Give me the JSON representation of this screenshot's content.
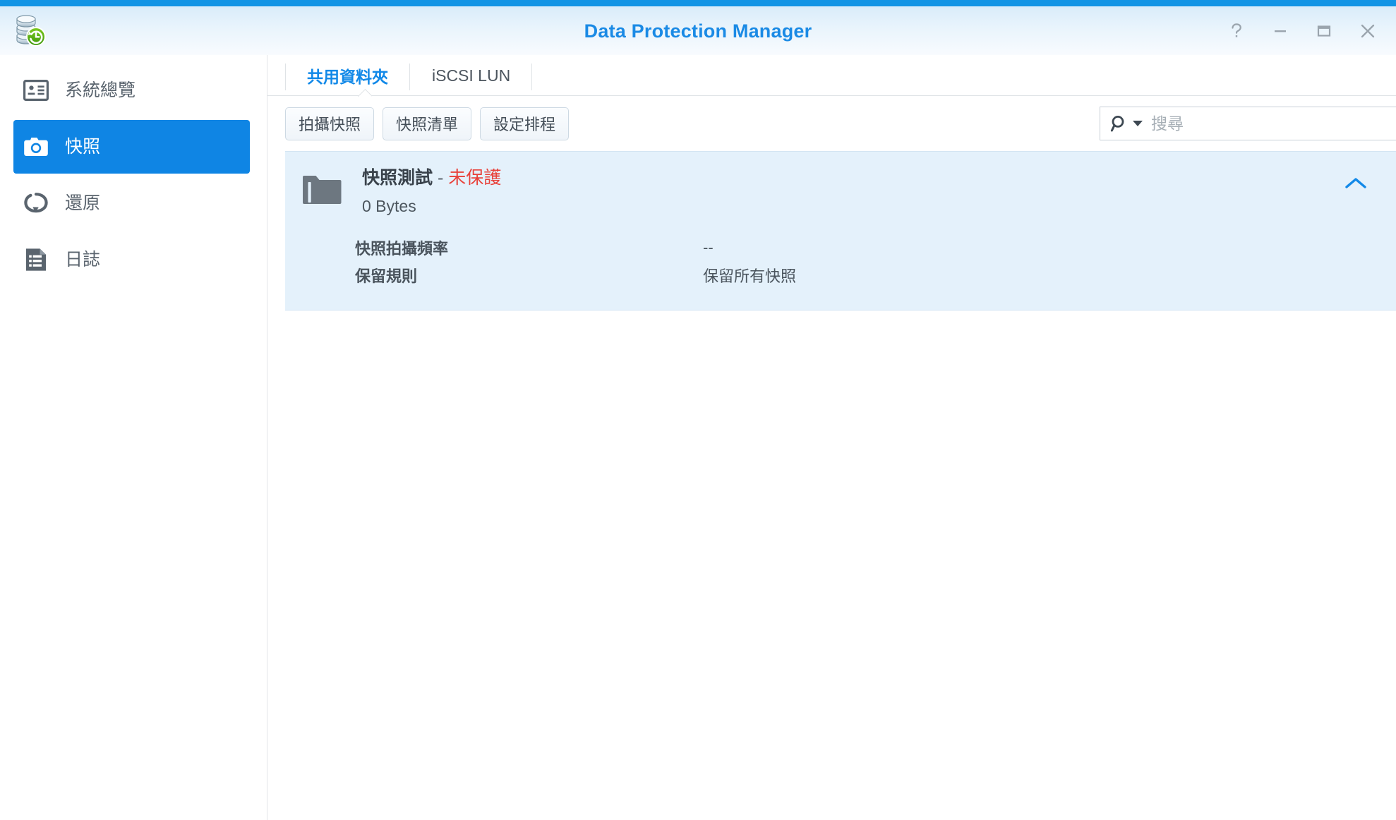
{
  "window": {
    "title": "Data Protection Manager",
    "app_icon": "database-restore-icon",
    "controls": [
      {
        "name": "help-button",
        "icon": "question-mark-icon",
        "label": "?"
      },
      {
        "name": "minimize-button",
        "icon": "minimize-icon",
        "label": "—"
      },
      {
        "name": "maximize-button",
        "icon": "maximize-icon",
        "label": "□"
      },
      {
        "name": "close-button",
        "icon": "close-icon",
        "label": "✕"
      }
    ]
  },
  "colors": {
    "accent_bar": "#1294e5",
    "title_text": "#1a8ae5",
    "sidebar_active_bg": "#0f85e4",
    "tab_active_text": "#1289e8",
    "card_bg": "#e4f1fb",
    "status_unprotected": "#e8413a",
    "chevron": "#1289e8"
  },
  "sidebar": {
    "items": [
      {
        "label": "系統總覽",
        "icon": "system-overview-icon",
        "active": false
      },
      {
        "label": "快照",
        "icon": "camera-icon",
        "active": true
      },
      {
        "label": "還原",
        "icon": "restore-icon",
        "active": false
      },
      {
        "label": "日誌",
        "icon": "log-document-icon",
        "active": false
      }
    ]
  },
  "tabs": [
    {
      "label": "共用資料夾",
      "active": true
    },
    {
      "label": "iSCSI LUN",
      "active": false
    }
  ],
  "toolbar": {
    "buttons": [
      {
        "label": "拍攝快照"
      },
      {
        "label": "快照清單"
      },
      {
        "label": "設定排程"
      }
    ]
  },
  "search": {
    "placeholder": "搜尋",
    "value": "",
    "icon": "search-icon",
    "dropdown_icon": "caret-down-icon"
  },
  "card": {
    "icon": "folder-icon",
    "name": "快照測試",
    "separator": "-",
    "status": "未保護",
    "size": "0 Bytes",
    "collapse_icon": "chevron-up-icon",
    "details": [
      {
        "label": "快照拍攝頻率",
        "value": "--"
      },
      {
        "label": "保留規則",
        "value": "保留所有快照"
      }
    ]
  }
}
